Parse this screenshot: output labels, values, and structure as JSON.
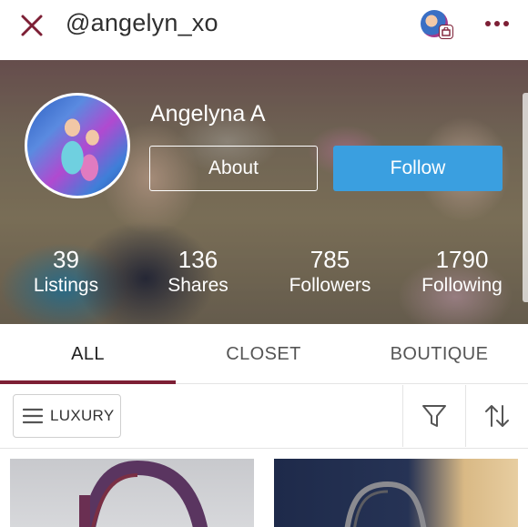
{
  "topbar": {
    "handle": "@angelyn_xo",
    "close_icon": "close-x-icon",
    "more_icon": "more-dots-icon",
    "accent_color": "#7d1f35"
  },
  "profile": {
    "name": "Angelyna A",
    "about_label": "About",
    "follow_label": "Follow",
    "follow_color": "#3a9fe0",
    "stats": [
      {
        "value": "39",
        "label": "Listings"
      },
      {
        "value": "136",
        "label": "Shares"
      },
      {
        "value": "785",
        "label": "Followers"
      },
      {
        "value": "1790",
        "label": "Following"
      }
    ]
  },
  "tabs": [
    {
      "label": "ALL",
      "active": true
    },
    {
      "label": "CLOSET",
      "active": false
    },
    {
      "label": "BOUTIQUE",
      "active": false
    }
  ],
  "filters": {
    "luxury_label": "LUXURY",
    "filter_icon": "funnel-icon",
    "sort_icon": "sort-arrows-icon"
  },
  "listings": [
    {
      "icon": "handbag-photo"
    },
    {
      "icon": "handbag-photo"
    }
  ]
}
